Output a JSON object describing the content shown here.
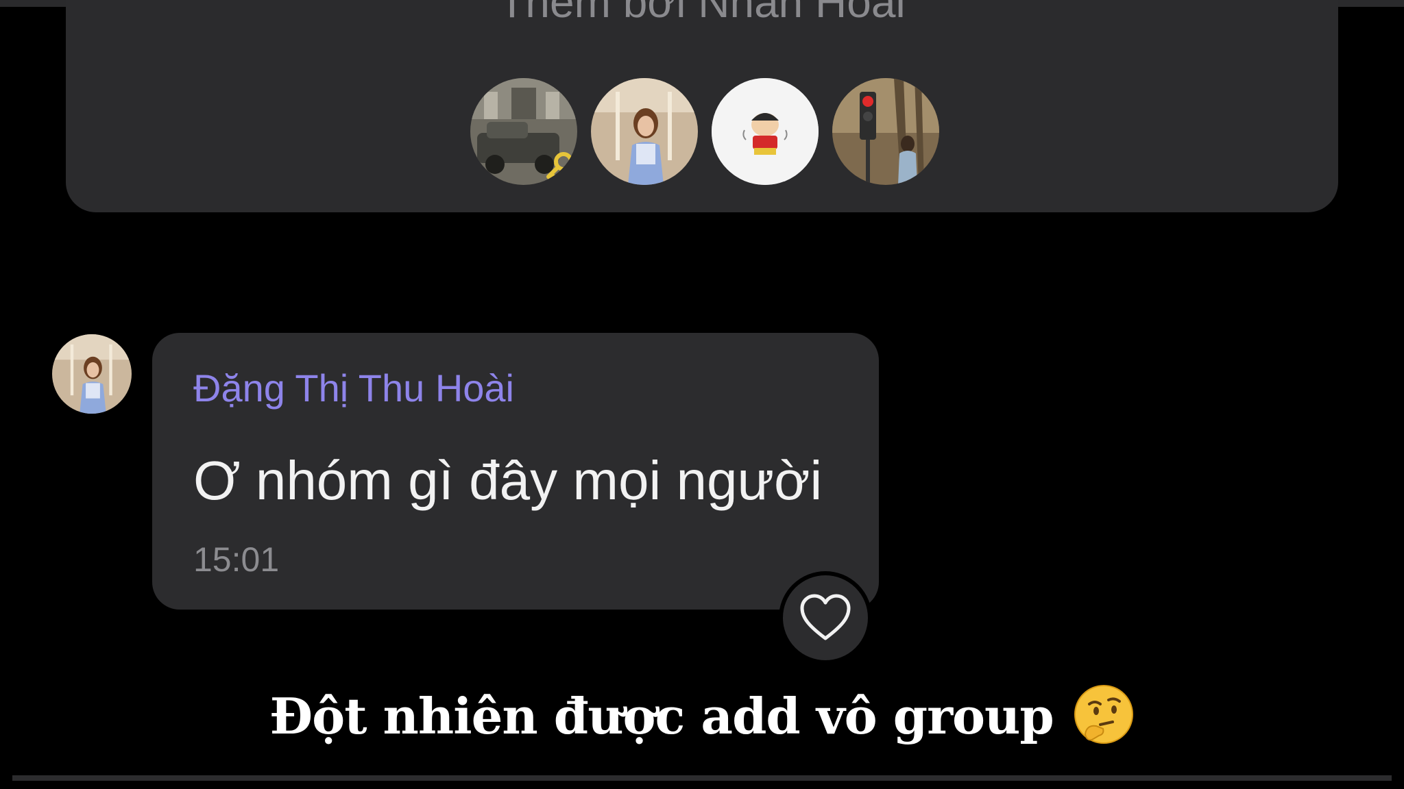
{
  "group_card": {
    "title": "Thêm bởi Nhàn Hoài",
    "members": [
      {
        "name": "member-avatar-car",
        "icon": "car-photo",
        "has_admin_key": true
      },
      {
        "name": "member-avatar-girl",
        "icon": "girl-photo",
        "has_admin_key": false
      },
      {
        "name": "member-avatar-cartoon",
        "icon": "cartoon-photo",
        "has_admin_key": false
      },
      {
        "name": "member-avatar-street",
        "icon": "street-photo",
        "has_admin_key": false
      }
    ],
    "admin_icon": "key-icon"
  },
  "message": {
    "sender": "Đặng Thị Thu Hoài",
    "text": "Ơ nhóm gì đây mọi người",
    "time": "15:01",
    "react_icon": "heart-icon"
  },
  "caption": {
    "text": "Đột nhiên được add vô group",
    "emoji": "🤔"
  },
  "colors": {
    "background": "#000000",
    "card": "#2b2b2d",
    "bubble": "#2c2c2e",
    "sender_name": "#8e84ea",
    "message_text": "#f2f2f2",
    "muted_text": "#8c8c90"
  }
}
